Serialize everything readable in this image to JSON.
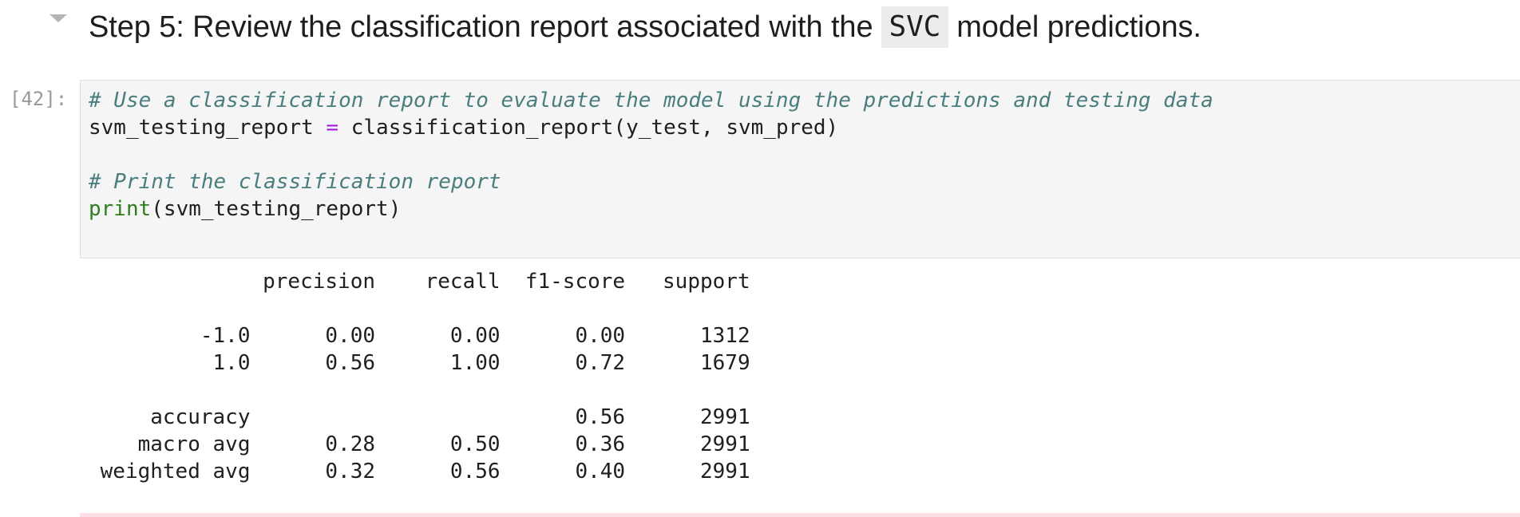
{
  "heading": {
    "before": "Step 5: Review the classification report associated with the",
    "code": "SVC",
    "after": "model predictions."
  },
  "cell": {
    "prompt": "[42]:",
    "lines": [
      {
        "parts": [
          {
            "cls": "cm",
            "text": "# Use a classification report to evaluate the model using the predictions and testing data"
          }
        ]
      },
      {
        "parts": [
          {
            "cls": "",
            "text": "svm_testing_report "
          },
          {
            "cls": "op",
            "text": "="
          },
          {
            "cls": "",
            "text": " classification_report(y_test, svm_pred)"
          }
        ]
      },
      {
        "parts": []
      },
      {
        "parts": [
          {
            "cls": "cm",
            "text": "# Print the classification report"
          }
        ]
      },
      {
        "parts": [
          {
            "cls": "bi",
            "text": "print"
          },
          {
            "cls": "",
            "text": "(svm_testing_report)"
          }
        ]
      }
    ]
  },
  "report": {
    "headers": [
      "",
      "precision",
      "recall",
      "f1-score",
      "support"
    ],
    "rows": [
      [
        "",
        "",
        "",
        "",
        ""
      ],
      [
        "-1.0",
        "0.00",
        "0.00",
        "0.00",
        "1312"
      ],
      [
        "1.0",
        "0.56",
        "1.00",
        "0.72",
        "1679"
      ],
      [
        "",
        "",
        "",
        "",
        ""
      ],
      [
        "accuracy",
        "",
        "",
        "0.56",
        "2991"
      ],
      [
        "macro avg",
        "0.28",
        "0.50",
        "0.36",
        "2991"
      ],
      [
        "weighted avg",
        "0.32",
        "0.56",
        "0.40",
        "2991"
      ]
    ]
  }
}
